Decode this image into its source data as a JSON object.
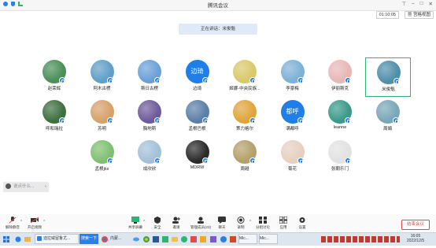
{
  "window": {
    "title": "腾讯会议",
    "timer": "01:10:05",
    "view_label": "宫格视图"
  },
  "speaking_banner": "正在讲话：米俊魁",
  "participants": [
    {
      "name": "赵荣辉",
      "bg": "#4a8f5a"
    },
    {
      "name": "阿木古楞",
      "bg": "#5f9fc8"
    },
    {
      "name": "斯日古楞",
      "bg": "#6aa0d8"
    },
    {
      "name": "边琦",
      "bg": "#1f7ee8",
      "avatar_text": "边琦"
    },
    {
      "name": "姬娜-中央民族...",
      "bg": "#d9c96a"
    },
    {
      "name": "李豪梅",
      "bg": "#7db1d6"
    },
    {
      "name": "伊丽斯克",
      "bg": "#e8b7b7"
    },
    {
      "name": "米俊魁",
      "bg": "#4f8faa"
    },
    {
      "name": "呼和瑞拉",
      "bg": "#3d6f3f"
    },
    {
      "name": "苏明",
      "bg": "#d7a16a"
    },
    {
      "name": "胸地斯",
      "bg": "#6e5a9a"
    },
    {
      "name": "孟根巴根",
      "bg": "#5b7fa8"
    },
    {
      "name": "策力格尔",
      "bg": "#e0a43a"
    },
    {
      "name": "满都呼",
      "bg": "#1f7ee8",
      "avatar_text": "都呼"
    },
    {
      "name": "leanne",
      "bg": "#3a9a8a"
    },
    {
      "name": "周娟",
      "bg": "#7aa6b8"
    },
    {
      "name": "孟根jks",
      "bg": "#7ec070"
    },
    {
      "name": "成欣欣",
      "bg": "#a4c0d8"
    },
    {
      "name": "MDRW",
      "bg": "#2a2a2a"
    },
    {
      "name": "周越",
      "bg": "#b4a06a"
    },
    {
      "name": "菊花",
      "bg": "#e6d0c0"
    },
    {
      "name": "张朝乐门",
      "bg": "#e2e2e2"
    }
  ],
  "chat_placeholder": "说点什么...",
  "controls": {
    "mute": "解除静音",
    "video": "开启视频",
    "share": "共享屏幕",
    "security": "安全",
    "invite": "邀请",
    "members": "管理成员(23)",
    "chat": "聊天",
    "record": "录制",
    "breakout": "分组讨论",
    "apps": "应用",
    "settings": "设置",
    "end": "结束会议"
  },
  "taskbar": {
    "items": [
      "迪拉威留鲁尤...",
      "搜索一下",
      "内蒙...",
      "Mic...",
      "Mic..."
    ],
    "time": "16:05",
    "date": "2022/12/5"
  },
  "colors": {
    "accent": "#2a7fe8",
    "selected": "#2bb673",
    "danger": "#e04a4a"
  }
}
